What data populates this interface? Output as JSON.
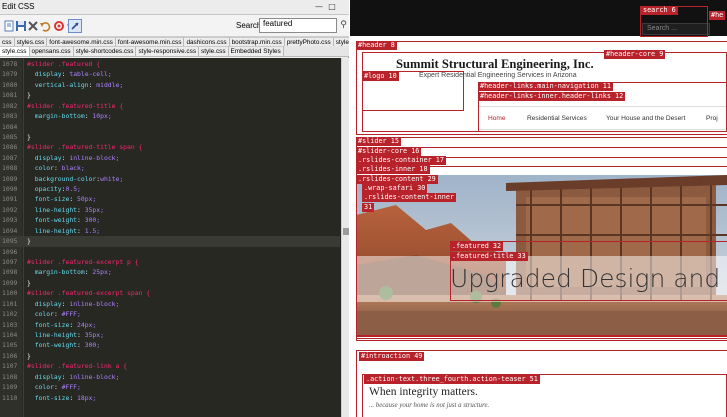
{
  "window": {
    "title": "Edit CSS"
  },
  "toolbar": {
    "search_label": "Search:",
    "search_value": "featured"
  },
  "file_tabs_row1": [
    "css",
    "styles.css",
    "font-awesome.min.css",
    "font-awesome.min.css",
    "dashicons.css",
    "bootstrap.min.css",
    "prettyPhoto.css",
    "style.css"
  ],
  "file_tabs_row2": [
    "style.css",
    "opensans.css",
    "style-shortcodes.css",
    "style-responsive.css",
    "style.css",
    "Embedded Styles"
  ],
  "code": [
    {
      "n": "1078",
      "t": "#slider .featured {"
    },
    {
      "n": "1079",
      "t": "  display: table-cell;"
    },
    {
      "n": "1080",
      "t": "  vertical-align: middle;"
    },
    {
      "n": "1081",
      "t": "}"
    },
    {
      "n": "1082",
      "t": "#slider .featured-title {"
    },
    {
      "n": "1083",
      "t": "  margin-bottom: 10px;"
    },
    {
      "n": "1084",
      "t": ""
    },
    {
      "n": "1085",
      "t": "}"
    },
    {
      "n": "1086",
      "t": "#slider .featured-title span {"
    },
    {
      "n": "1087",
      "t": "  display: inline-block;"
    },
    {
      "n": "1088",
      "t": "  color: black;"
    },
    {
      "n": "1089",
      "t": "  background-color:white;"
    },
    {
      "n": "1090",
      "t": "  opacity:0.5;"
    },
    {
      "n": "1091",
      "t": "  font-size: 50px;"
    },
    {
      "n": "1092",
      "t": "  line-height: 35px;"
    },
    {
      "n": "1093",
      "t": "  font-weight: 300;"
    },
    {
      "n": "1094",
      "t": "  line-height: 1.5;"
    },
    {
      "n": "1095",
      "t": "}"
    },
    {
      "n": "1096",
      "t": ""
    },
    {
      "n": "1097",
      "t": "#slider .featured-excerpt p {"
    },
    {
      "n": "1098",
      "t": "  margin-bottom: 25px;"
    },
    {
      "n": "1099",
      "t": "}"
    },
    {
      "n": "1100",
      "t": "#slider .featured-excerpt span {"
    },
    {
      "n": "1101",
      "t": "  display: inline-block;"
    },
    {
      "n": "1102",
      "t": "  color: #FFF;"
    },
    {
      "n": "1103",
      "t": "  font-size: 24px;"
    },
    {
      "n": "1104",
      "t": "  line-height: 35px;"
    },
    {
      "n": "1105",
      "t": "  font-weight: 300;"
    },
    {
      "n": "1106",
      "t": "}"
    },
    {
      "n": "1107",
      "t": "#slider .featured-link a {"
    },
    {
      "n": "1108",
      "t": "  display: inline-block;"
    },
    {
      "n": "1109",
      "t": "  color: #FFF;"
    },
    {
      "n": "1110",
      "t": "  font-size: 18px;"
    }
  ],
  "preview": {
    "search_placeholder": "Search ...",
    "brand_title": "Summit Structural Engineering, Inc.",
    "brand_tagline": "Expert Residential Engineering Services in Arizona",
    "nav": [
      "Home",
      "Residential Services",
      "Your House and the Desert",
      "Proj"
    ],
    "slider_title": "Upgraded Design and R",
    "intro_heading": "When integrity matters.",
    "intro_sub": "... because your home is not just a structure.",
    "debug_labels": {
      "search": "search 6",
      "header_right": "#he",
      "header": "#header 8",
      "header_core": "#header-core 9",
      "logo": "#logo 10",
      "nav_main": "#header-links.main-navigation 11",
      "nav_inner": "#header-links-inner.header-links 12",
      "slider": "#slider 15",
      "slider_core": "#slider-core 16",
      "rslides_container": ".rslides-container 17",
      "rslides_inner": ".rslides-inner 18",
      "rslides_content": ".rslides-content 29",
      "wrap_safari": ".wrap-safari 30",
      "rslides_content_inner": ".rslides-content-inner",
      "rslides_content_inner_num": "31",
      "featured": ".featured 32",
      "featured_title": ".featured-title 33",
      "introaction": "#introaction 49",
      "action_text": ".action-text.three_fourth.action-teaser 51"
    }
  },
  "colors": {
    "debug_red": "#b8222a",
    "editor_bg": "#272822",
    "selector": "#f92672",
    "property": "#66d9ef",
    "value": "#ae81ff"
  }
}
